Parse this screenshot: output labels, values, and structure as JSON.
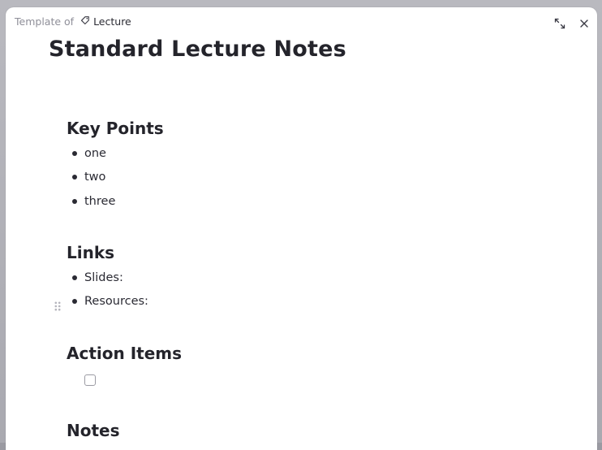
{
  "breadcrumb": {
    "prefix": "Template of",
    "tag_label": "Lecture"
  },
  "document": {
    "title": "Standard Lecture Notes",
    "sections": {
      "key_points": {
        "heading": "Key Points",
        "items": [
          "one",
          "two",
          "three"
        ]
      },
      "links": {
        "heading": "Links",
        "items": [
          "Slides:",
          "Resources:"
        ]
      },
      "action_items": {
        "heading": "Action Items",
        "checkbox_checked": false
      },
      "notes": {
        "heading": "Notes"
      }
    }
  },
  "icons": {
    "tag": "tag-icon",
    "expand": "expand-icon",
    "close": "close-icon",
    "drag": "drag-handle-icon"
  },
  "colors": {
    "text": "#24242b",
    "muted": "#8f8f99",
    "backdrop": "#a9a9b0"
  }
}
